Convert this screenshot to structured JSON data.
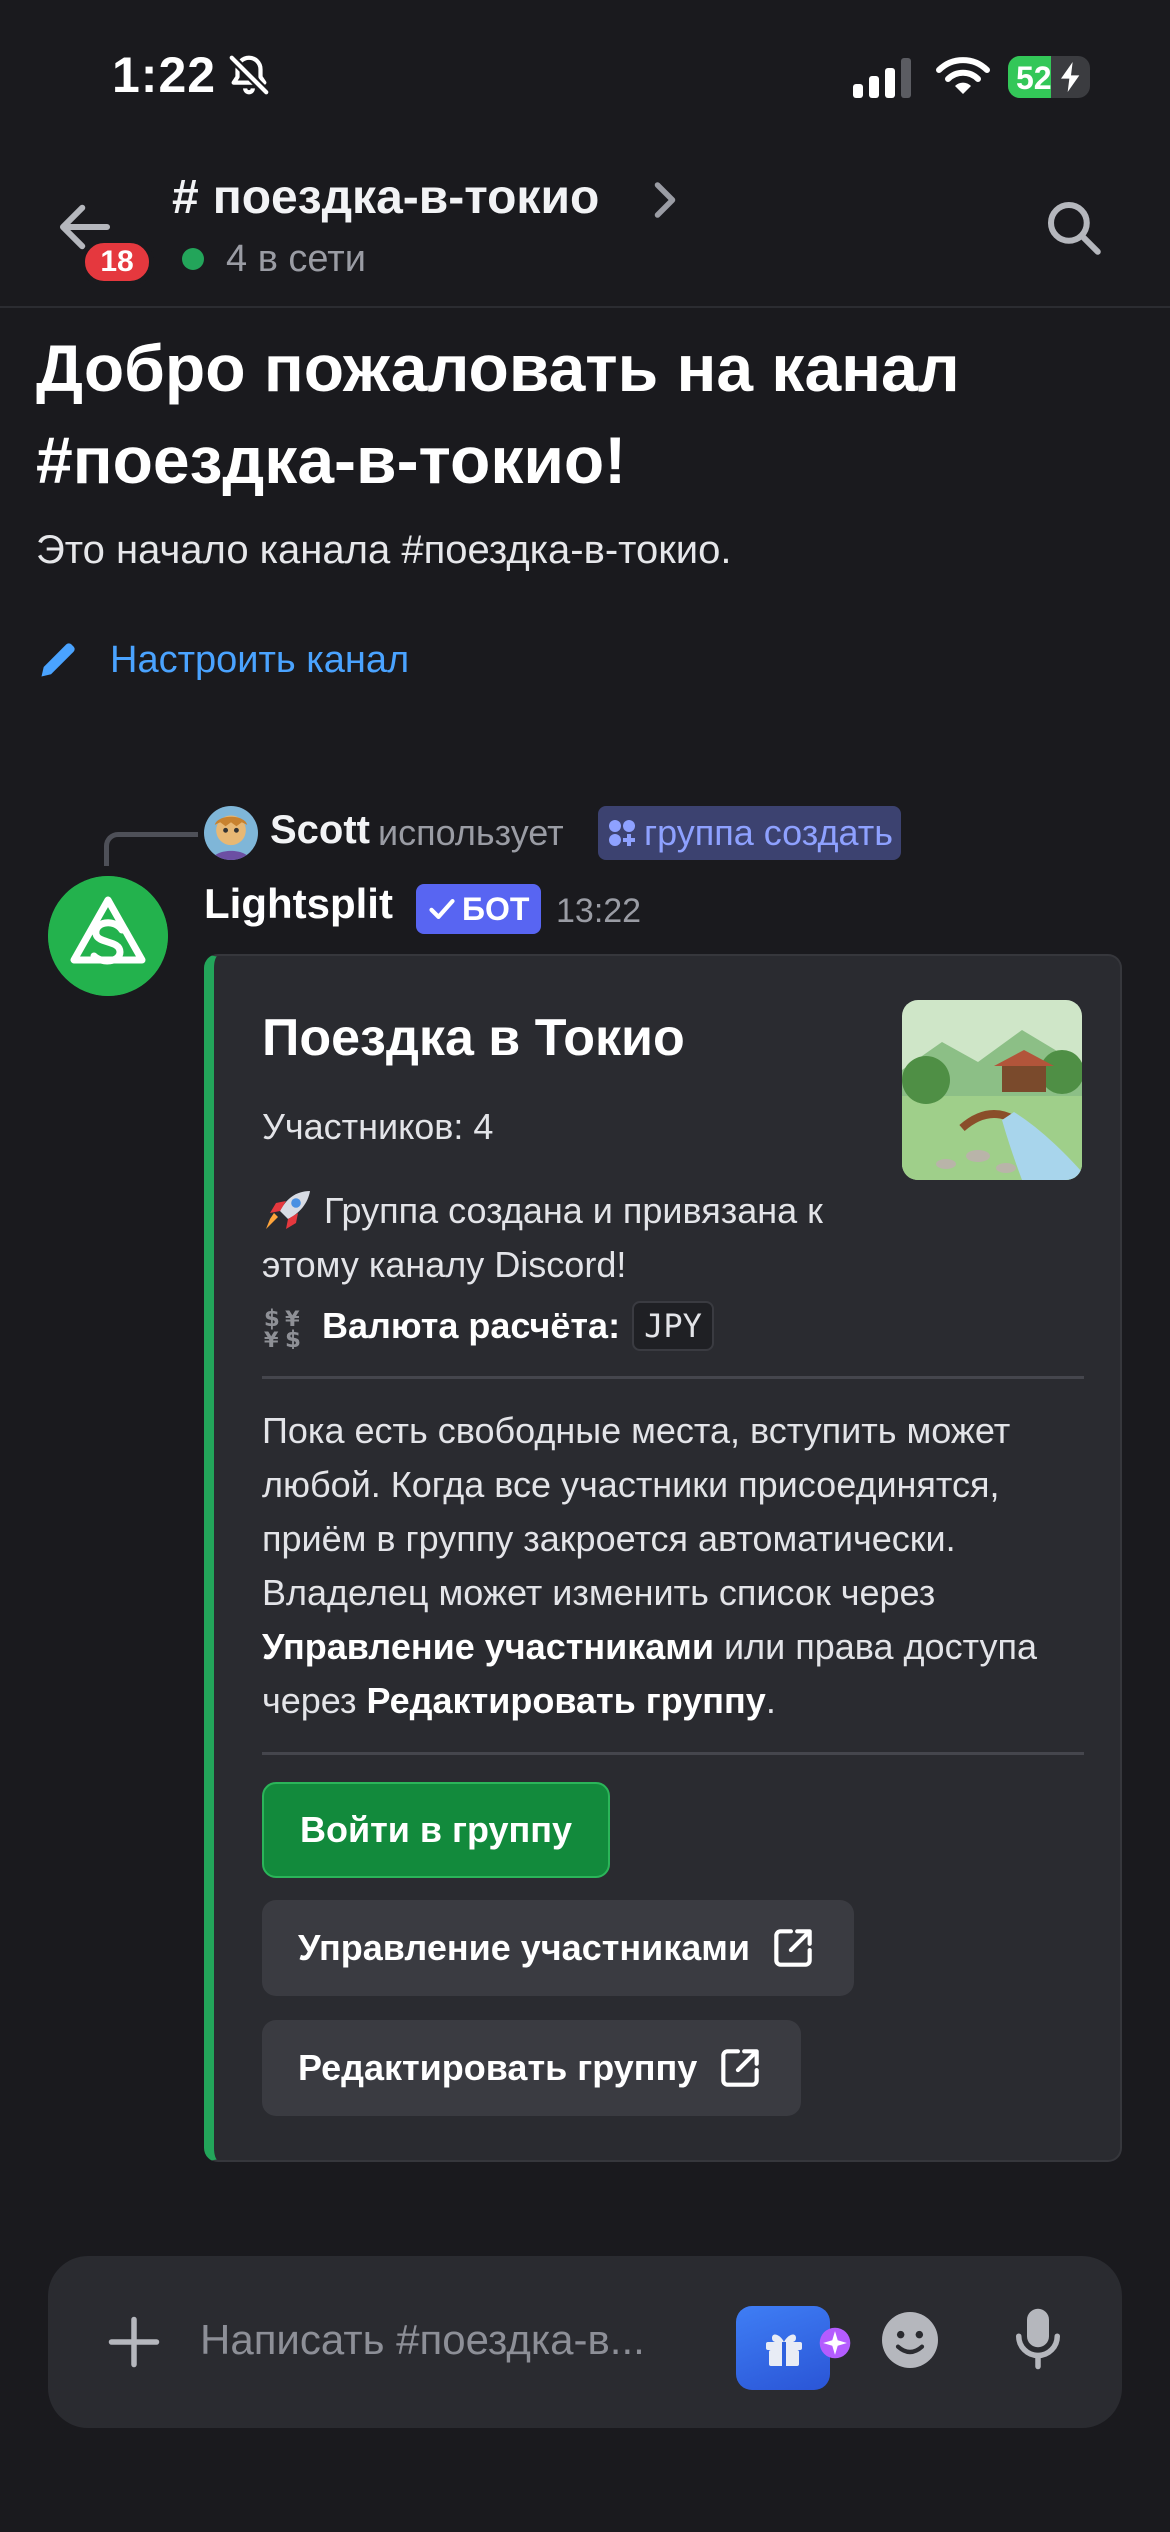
{
  "status_bar": {
    "time": "1:22",
    "battery_percent": "52",
    "battery_level": 0.52,
    "icons": [
      "bell-slash-icon",
      "cellular-signal-icon",
      "wifi-icon",
      "battery-charging-icon"
    ]
  },
  "header": {
    "unread_count": "18",
    "channel_hash": "#",
    "channel_name": "поездка-в-токио",
    "online_text": "4 в сети",
    "icons": [
      "back-arrow-icon",
      "chevron-right-icon",
      "search-icon"
    ]
  },
  "welcome": {
    "title": "Добро пожаловать на канал #поездка-в-токио!",
    "subtitle": "Это начало канала #поездка-в-токио.",
    "setup_link": "Настроить канал"
  },
  "message": {
    "reply_user": "Scott",
    "reply_uses": "использует",
    "command_name": "группа создать",
    "author": "Lightsplit",
    "bot_tag": "БОТ",
    "time": "13:22"
  },
  "embed": {
    "accent_color": "#23a55a",
    "title": "Поездка в Токио",
    "members": "Участников: 4",
    "desc_line": "Группа создана и привязана к этому каналу Discord!",
    "currency_label": "Валюта расчёта:",
    "currency_code": "JPY",
    "body_part1": "Пока есть свободные места, вступить может любой. Когда все участники присоединятся, приём в группу закроется автоматически. Владелец может изменить список через ",
    "body_bold1": "Управление участниками",
    "body_part2": " или права доступа через ",
    "body_bold2": "Редактировать группу",
    "body_part3": ".",
    "buttons": {
      "join": "Войти в группу",
      "manage": "Управление участниками",
      "edit": "Редактировать группу"
    }
  },
  "composer": {
    "placeholder": "Написать #поездка-в...",
    "icons": [
      "plus-icon",
      "gift-icon",
      "emoji-icon",
      "microphone-icon"
    ]
  }
}
